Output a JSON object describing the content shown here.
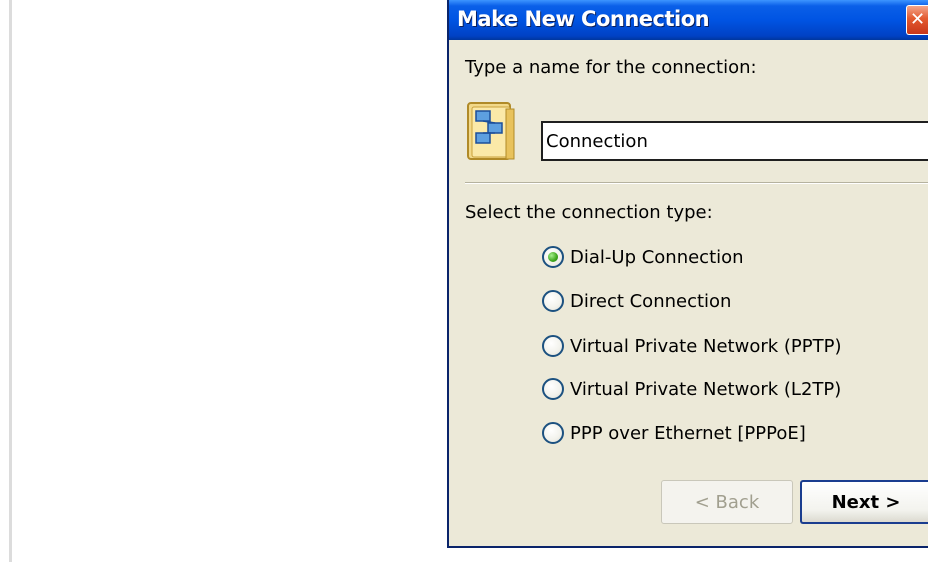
{
  "dialog": {
    "title": "Make New Connection",
    "close_glyph": "✕",
    "name_prompt": "Type a name for the connection:",
    "name_value": "Connection",
    "type_prompt": "Select the connection type:",
    "options": [
      {
        "label": "Dial-Up Connection",
        "checked": true
      },
      {
        "label": "Direct Connection",
        "checked": false
      },
      {
        "label": "Virtual Private Network (PPTP)",
        "checked": false
      },
      {
        "label": "Virtual Private Network (L2TP)",
        "checked": false
      },
      {
        "label": "PPP over Ethernet [PPPoE]",
        "checked": false
      }
    ],
    "back_label": "< Back",
    "next_label": "Next >",
    "icon": "network-connection-icon"
  },
  "colors": {
    "titlebar": "#0054e3",
    "dialog_bg": "#ece9d8",
    "close": "#e35a2f",
    "radio_selected": "#3ea51c"
  }
}
